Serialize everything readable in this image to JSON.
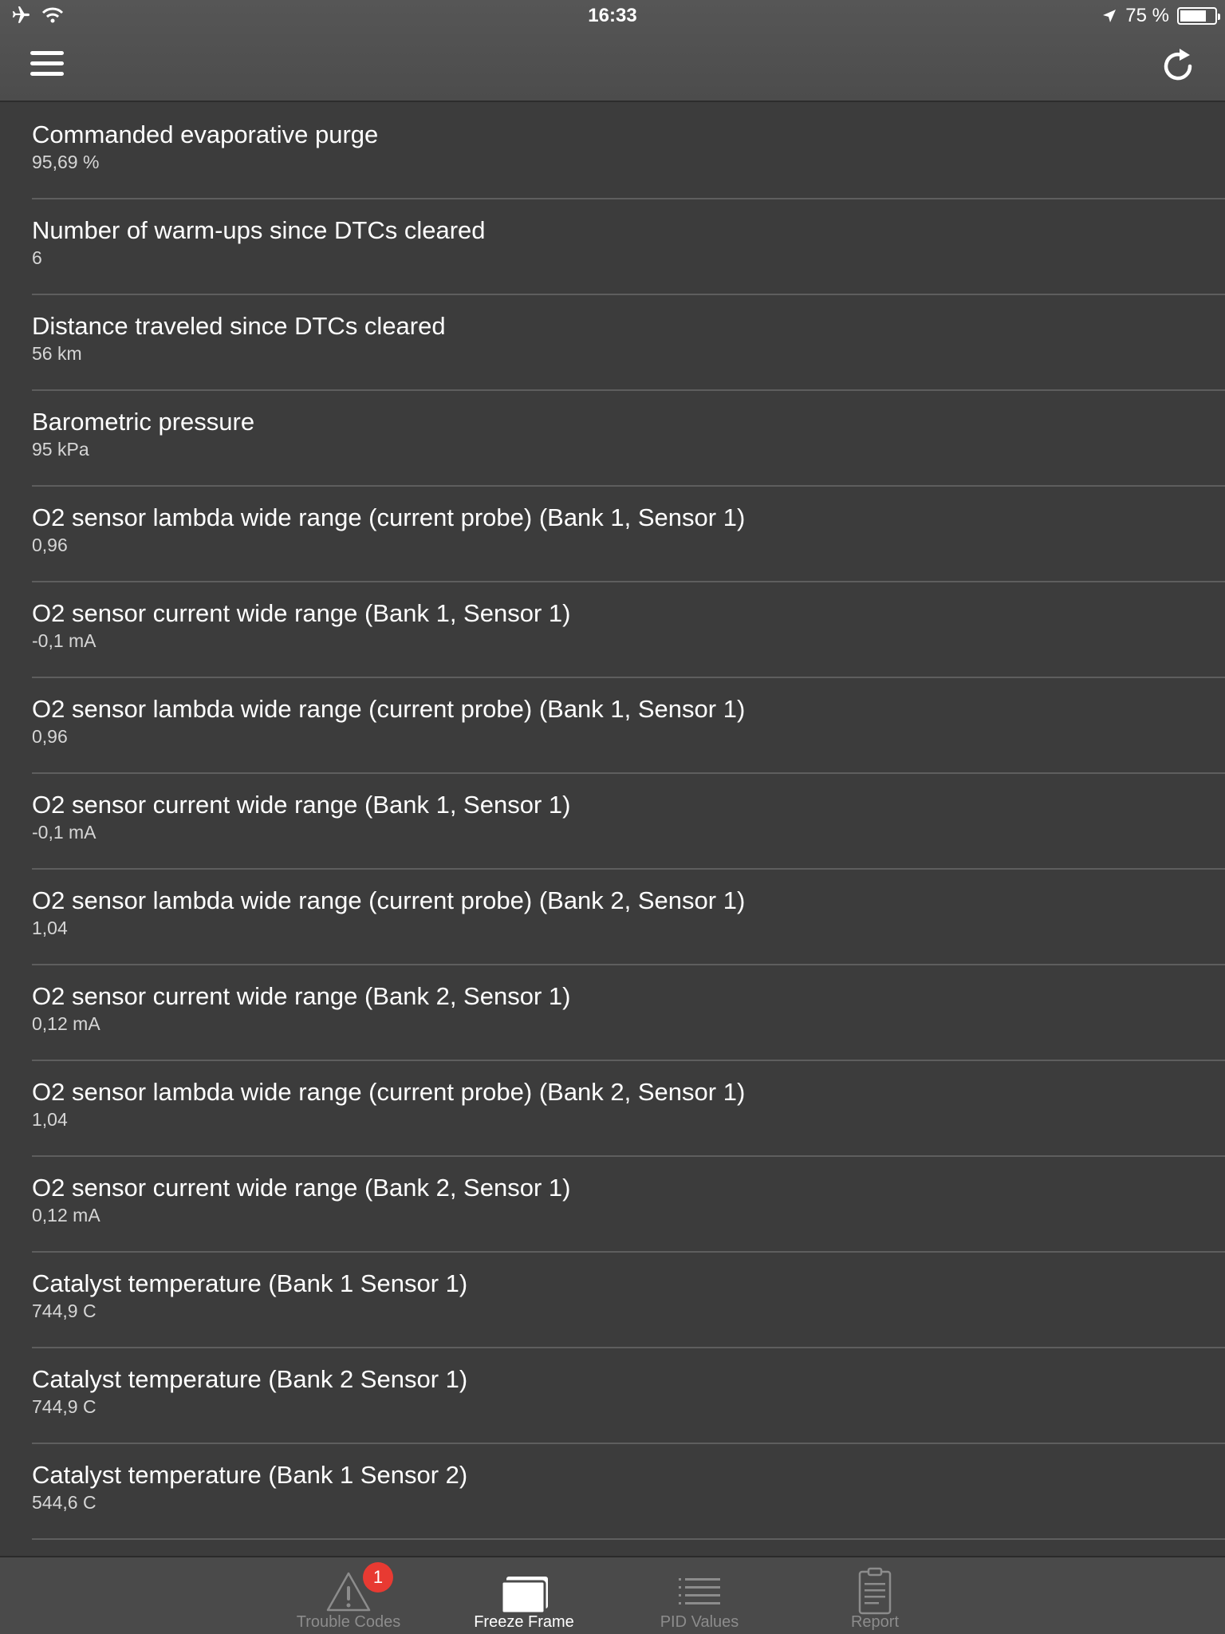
{
  "status_bar": {
    "time": "16:33",
    "battery_text": "75 %",
    "battery_level": 0.75,
    "icons": [
      "airplane-icon",
      "wifi-icon",
      "location-arrow-icon",
      "battery-icon"
    ]
  },
  "nav_bar": {
    "menu_icon": "hamburger-menu-icon",
    "refresh_icon": "refresh-icon"
  },
  "items": [
    {
      "label": "Commanded evaporative purge",
      "value": "95,69 %"
    },
    {
      "label": "Number of warm-ups since DTCs cleared",
      "value": "6"
    },
    {
      "label": "Distance traveled since DTCs cleared",
      "value": "56 km"
    },
    {
      "label": "Barometric pressure",
      "value": "95 kPa"
    },
    {
      "label": "O2 sensor lambda wide range (current probe)  (Bank 1, Sensor 1)",
      "value": "0,96"
    },
    {
      "label": "O2 sensor current wide range (Bank 1, Sensor 1)",
      "value": "-0,1 mA"
    },
    {
      "label": "O2 sensor lambda wide range (current probe)  (Bank 1, Sensor 1)",
      "value": "0,96"
    },
    {
      "label": "O2 sensor current wide range (Bank 1, Sensor 1)",
      "value": "-0,1 mA"
    },
    {
      "label": "O2 sensor lambda wide range (current probe)  (Bank 2, Sensor 1)",
      "value": "1,04"
    },
    {
      "label": "O2 sensor current wide range (Bank 2, Sensor 1)",
      "value": "0,12 mA"
    },
    {
      "label": "O2 sensor lambda wide range (current probe)  (Bank 2, Sensor 1)",
      "value": "1,04"
    },
    {
      "label": "O2 sensor current wide range (Bank 2, Sensor 1)",
      "value": "0,12 mA"
    },
    {
      "label": "Catalyst temperature (Bank 1 Sensor 1)",
      "value": "744,9 C"
    },
    {
      "label": "Catalyst temperature (Bank 2 Sensor 1)",
      "value": "744,9 C"
    },
    {
      "label": "Catalyst temperature (Bank 1 Sensor 2)",
      "value": "544,6 C"
    }
  ],
  "tab_bar": {
    "tabs": [
      {
        "label": "Trouble Codes",
        "icon": "warning-triangle-icon",
        "badge": "1",
        "active": false
      },
      {
        "label": "Freeze Frame",
        "icon": "freeze-frame-icon",
        "active": true
      },
      {
        "label": "PID Values",
        "icon": "list-icon",
        "active": false
      },
      {
        "label": "Report",
        "icon": "clipboard-icon",
        "active": false
      }
    ]
  },
  "colors": {
    "background": "#3c3c3c",
    "bar": "#4a4a4a",
    "separator": "#5e5e5e",
    "badge": "#e83a32",
    "inactive_tab": "#8c8c8c"
  }
}
